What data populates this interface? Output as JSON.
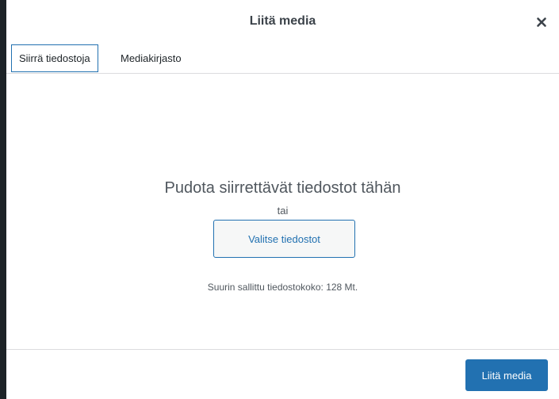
{
  "modal": {
    "title": "Liitä media",
    "close_icon": "close-icon"
  },
  "tabs": [
    {
      "label": "Siirrä tiedostoja",
      "active": true
    },
    {
      "label": "Mediakirjasto",
      "active": false
    }
  ],
  "uploader": {
    "drop_text": "Pudota siirrettävät tiedostot tähän",
    "or_text": "tai",
    "select_button": "Valitse tiedostot",
    "max_size": "Suurin sallittu tiedostokoko: 128 Mt."
  },
  "footer": {
    "insert_button": "Liitä media"
  },
  "colors": {
    "accent": "#2271b1",
    "text": "#3c434a",
    "border": "#dcdcde"
  }
}
